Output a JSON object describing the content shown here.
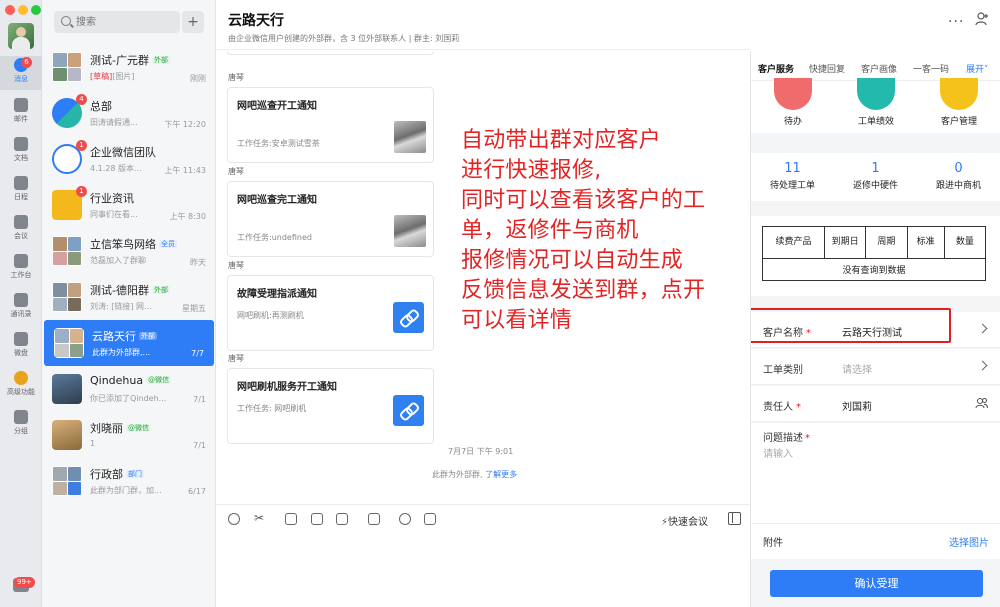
{
  "rail": {
    "nav": [
      {
        "label": "消息",
        "badge": "6"
      },
      {
        "label": "邮件"
      },
      {
        "label": "文档"
      },
      {
        "label": "日程"
      },
      {
        "label": "会议"
      },
      {
        "label": "工作台"
      },
      {
        "label": "通讯录"
      },
      {
        "label": "微盘"
      },
      {
        "label": "高级功能"
      },
      {
        "label": "分组"
      }
    ],
    "bottom_badge": "99+"
  },
  "conversation_list": {
    "search_placeholder": "搜索",
    "items": [
      {
        "title": "测试-广元群",
        "tag": "外部",
        "draft": "[草稿]",
        "subtitle": "[图片]",
        "time": "刚刚"
      },
      {
        "title": "总部",
        "badge": "4",
        "subtitle": "田涛请假通...",
        "time": "下午 12:20"
      },
      {
        "title": "企业微信团队",
        "badge": "1",
        "subtitle": "4.1.28 版本...",
        "time": "上午 11:43"
      },
      {
        "title": "行业资讯",
        "badge": "1",
        "subtitle": "同事们在看...",
        "time": "上午 8:30"
      },
      {
        "title": "立信笨鸟网络",
        "tag": "全员",
        "subtitle": "范磊加入了群聊",
        "time": "昨天"
      },
      {
        "title": "测试-德阳群",
        "tag": "外部",
        "subtitle": "刘涛: [链接] 网...",
        "time": "星期五"
      },
      {
        "title": "云路天行",
        "tag": "外部",
        "subtitle": "此群为外部群,...",
        "time": "7/7"
      },
      {
        "title": "Qindehua",
        "tag": "@微信",
        "subtitle": "你已添加了Qindeh...",
        "time": "7/1"
      },
      {
        "title": "刘晓丽",
        "tag": "@微信",
        "subtitle": "1",
        "time": "7/1"
      },
      {
        "title": "行政部",
        "tag": "部门",
        "subtitle": "此群为部门群，加...",
        "time": "6/17"
      }
    ]
  },
  "chat": {
    "title": "云路天行",
    "subtitle": "由企业微信用户创建的外部群，含 3 位外部联系人 | 群主: 刘国莉",
    "messages": [
      {
        "sender": "唐琴",
        "title": "网吧巡查开工通知",
        "desc": "工作任务:安卓测试雪茶"
      },
      {
        "sender": "唐琴",
        "title": "网吧巡查完工通知",
        "desc": "工作任务:undefined"
      },
      {
        "sender": "唐琴",
        "title": "故障受理指派通知",
        "desc": "网吧刷机:再测刷机"
      },
      {
        "sender": "唐琴",
        "title": "网吧刷机服务开工通知",
        "desc": "工作任务: 网吧刷机"
      }
    ],
    "timestamp": "7月7日 下午 9:01",
    "notice": "此群为外部群,",
    "notice_link": "了解更多",
    "annotation": "自动带出群对应客户\n进行快速报修,\n同时可以查看该客户的工\n单，返修件与商机\n报修情况可以自动生成\n反馈信息发送到群，点开\n可以看详情",
    "quick_meeting": "快速会议"
  },
  "side_panel": {
    "tabs": [
      "客户服务",
      "快捷回复",
      "客户画像",
      "一客一码",
      "展开"
    ],
    "quick_icons": [
      {
        "label": "待办",
        "color": "#f06b6b"
      },
      {
        "label": "工单绩效",
        "color": "#23b9ad"
      },
      {
        "label": "客户管理",
        "color": "#f5c21b"
      }
    ],
    "stats": [
      {
        "value": "11",
        "label": "待处理工单"
      },
      {
        "value": "1",
        "label": "返修中硬件"
      },
      {
        "value": "0",
        "label": "跟进中商机"
      }
    ],
    "table": {
      "headers": [
        "续费产品",
        "到期日",
        "周期",
        "标准",
        "数量"
      ],
      "empty": "没有查询到数据"
    },
    "form": {
      "customer_label": "客户名称",
      "customer_value": "云路天行测试",
      "type_label": "工单类别",
      "type_placeholder": "请选择",
      "owner_label": "责任人",
      "owner_value": "刘国莉",
      "desc_label": "问题描述",
      "desc_placeholder": "请输入",
      "attach_label": "附件",
      "attach_action": "选择图片",
      "required_mark": "*"
    },
    "confirm_label": "确认受理"
  }
}
